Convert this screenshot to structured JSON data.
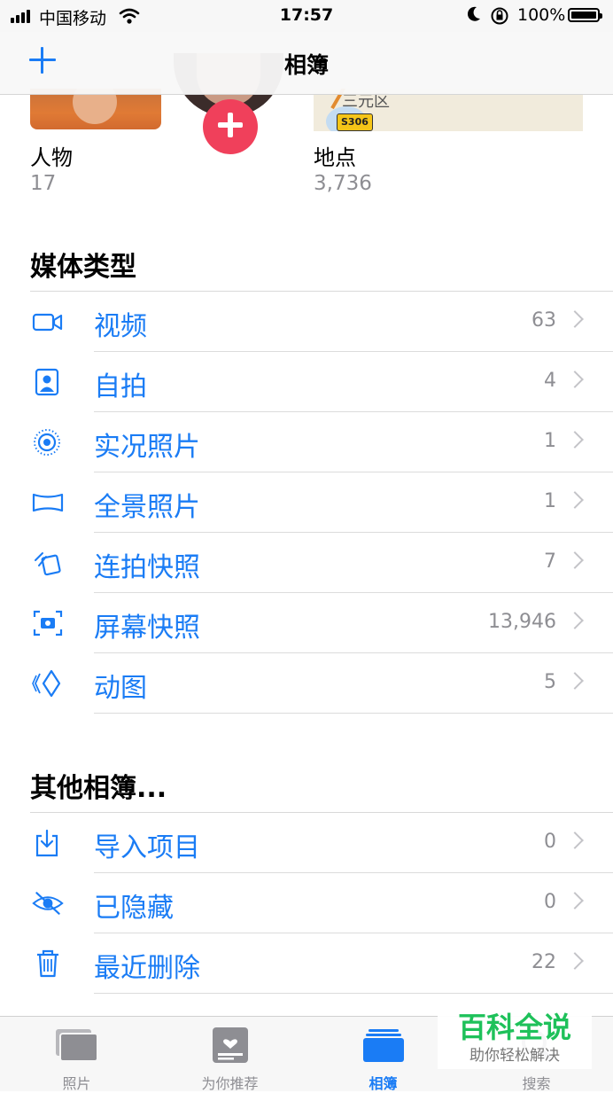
{
  "status_bar": {
    "carrier": "中国移动",
    "time": "17:57",
    "battery": "100%"
  },
  "nav": {
    "title": "相簿"
  },
  "albums_top": [
    {
      "title": "人物",
      "count": "17"
    },
    {
      "title": "地点",
      "count": "3,736"
    }
  ],
  "map_thumbnail": {
    "area_label": "三元区",
    "road_label": "S306"
  },
  "media_types": {
    "header": "媒体类型",
    "items": [
      {
        "label": "视频",
        "count": "63",
        "icon": "video-icon"
      },
      {
        "label": "自拍",
        "count": "4",
        "icon": "selfie-icon"
      },
      {
        "label": "实况照片",
        "count": "1",
        "icon": "live-photo-icon"
      },
      {
        "label": "全景照片",
        "count": "1",
        "icon": "panorama-icon"
      },
      {
        "label": "连拍快照",
        "count": "7",
        "icon": "burst-icon"
      },
      {
        "label": "屏幕快照",
        "count": "13,946",
        "icon": "screenshot-icon"
      },
      {
        "label": "动图",
        "count": "5",
        "icon": "animated-icon"
      }
    ]
  },
  "other_albums": {
    "header": "其他相簿...",
    "items": [
      {
        "label": "导入项目",
        "count": "0",
        "icon": "import-icon"
      },
      {
        "label": "已隐藏",
        "count": "0",
        "icon": "hidden-eye-icon"
      },
      {
        "label": "最近删除",
        "count": "22",
        "icon": "trash-icon"
      }
    ]
  },
  "tabs": [
    {
      "label": "照片",
      "icon": "photos-tab-icon"
    },
    {
      "label": "为你推荐",
      "icon": "for-you-tab-icon"
    },
    {
      "label": "相簿",
      "icon": "albums-tab-icon",
      "active": true
    },
    {
      "label": "搜索",
      "icon": "search-tab-icon"
    }
  ],
  "watermark": {
    "title": "百科全说",
    "subtitle": "助你轻松解决"
  },
  "colors": {
    "accent": "#1a7cf5",
    "badge": "#f0405b",
    "secondary_text": "#8e8e93",
    "watermark_green": "#1ec15a"
  }
}
